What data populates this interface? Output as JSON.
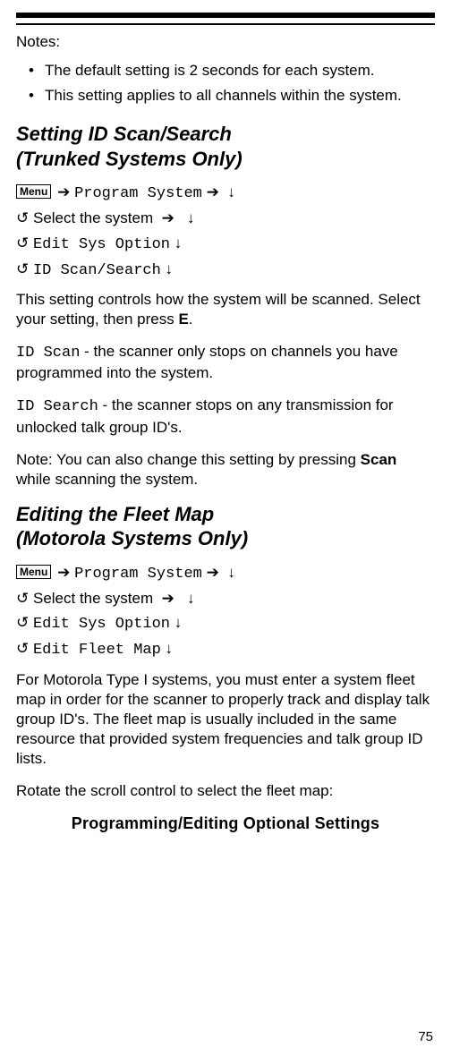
{
  "notesLabel": "Notes:",
  "notes": [
    "The default setting is 2 seconds for each system.",
    "This setting applies to all channels within the system."
  ],
  "section1": {
    "titleLine1": "Setting ID Scan/Search",
    "titleLine2": "(Trunked Systems Only)",
    "nav": {
      "menu": "Menu",
      "programSystem": "Program System",
      "selectSystem": "Select the system",
      "editSysOption": "Edit Sys Option",
      "leaf": "ID Scan/Search"
    },
    "intro": "This setting controls how the system will be scanned. Select your setting, then press ",
    "introKey": "E",
    "introAfter": ".",
    "idScanTerm": "ID Scan",
    "idScanDesc": " - the scanner only stops on channels you have programmed into the system.",
    "idSearchTerm": "ID Search",
    "idSearchDesc": " - the scanner stops on any transmission for unlocked talk group ID's.",
    "note": "Note: You can also change this setting by pressing ",
    "noteKey": "Scan",
    "noteAfter": " while scanning the system."
  },
  "section2": {
    "titleLine1": "Editing the Fleet Map",
    "titleLine2": "(Motorola Systems Only)",
    "nav": {
      "menu": "Menu",
      "programSystem": "Program System",
      "selectSystem": "Select the system",
      "editSysOption": "Edit Sys Option",
      "leaf": "Edit Fleet Map"
    },
    "body": "For Motorola Type I systems, you must enter a system fleet map in order for the scanner to properly track and display talk group ID's. The fleet map is usually included in the same resource that provided system frequencies and talk group ID lists.",
    "rotate": "Rotate the scroll control to select the fleet map:"
  },
  "footerTitle": "Programming/Editing Optional Settings",
  "pageNumber": "75",
  "glyphs": {
    "arrowRight": "➔",
    "arrowDown": "↓",
    "rotate": "↺"
  }
}
